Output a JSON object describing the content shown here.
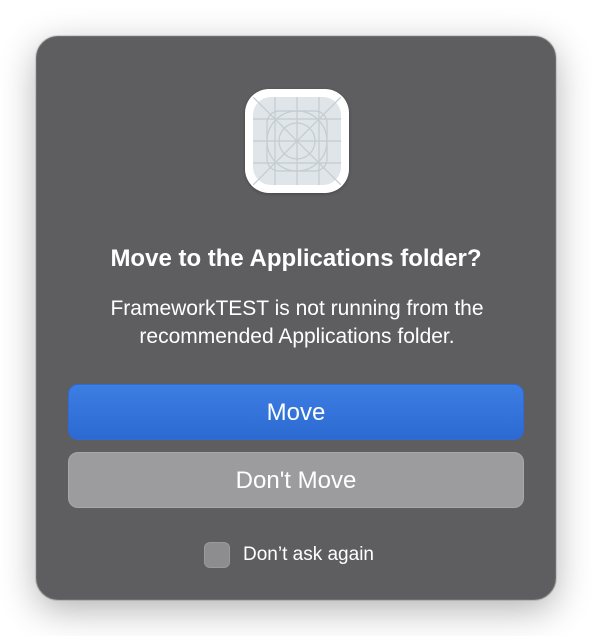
{
  "dialog": {
    "icon": "generic-app-icon",
    "title": "Move to the Applications folder?",
    "message": "FrameworkTEST is not running from the recommended Applications folder.",
    "primary_button": "Move",
    "secondary_button": "Don't Move",
    "checkbox_label": "Don’t ask again",
    "checkbox_checked": false
  },
  "colors": {
    "dialog_background": "#5e5e60",
    "accent": "#3574dc",
    "secondary_button": "#9c9c9e"
  }
}
